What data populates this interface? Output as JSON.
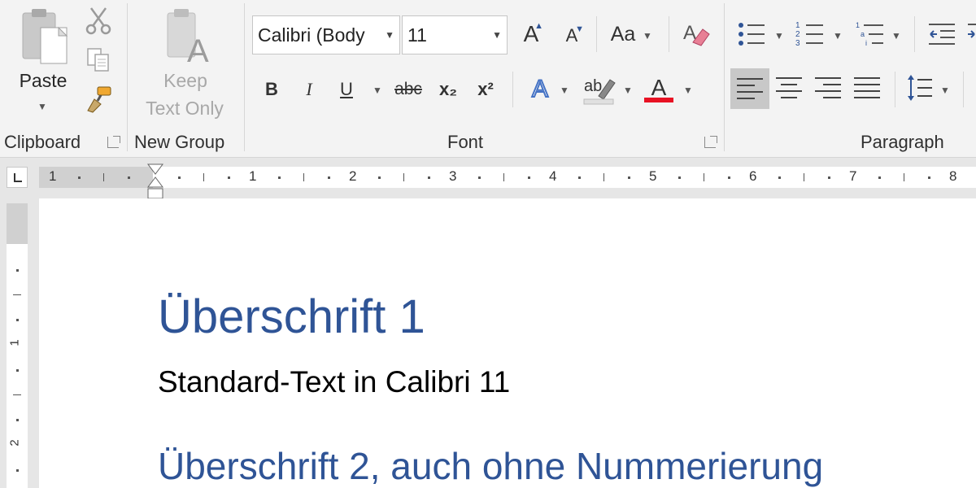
{
  "clipboard": {
    "paste_label": "Paste",
    "group_label": "Clipboard"
  },
  "new_group": {
    "keep_label_line1": "Keep",
    "keep_label_line2": "Text Only",
    "group_label": "New Group"
  },
  "font": {
    "font_name": "Calibri (Body",
    "font_size": "11",
    "group_label": "Font",
    "bold": "B",
    "italic": "I",
    "underline": "U",
    "strikethrough": "abc",
    "subscript": "x₂",
    "superscript": "x²",
    "grow": "A",
    "shrink": "A",
    "change_case": "Aa",
    "text_effects": "A",
    "highlight": "ab",
    "font_color": "A",
    "font_color_value": "#e81123"
  },
  "paragraph": {
    "group_label": "Paragraph"
  },
  "ruler": {
    "numbers": [
      "1",
      "1",
      "2",
      "3",
      "4",
      "5",
      "6",
      "7",
      "8"
    ],
    "vertical_numbers": [
      "1",
      "2"
    ]
  },
  "document": {
    "heading1": "Überschrift 1",
    "body": "Standard-Text in Calibri 11",
    "heading2": "Überschrift 2, auch ohne Nummerierung",
    "heading_color": "#2f5496"
  }
}
